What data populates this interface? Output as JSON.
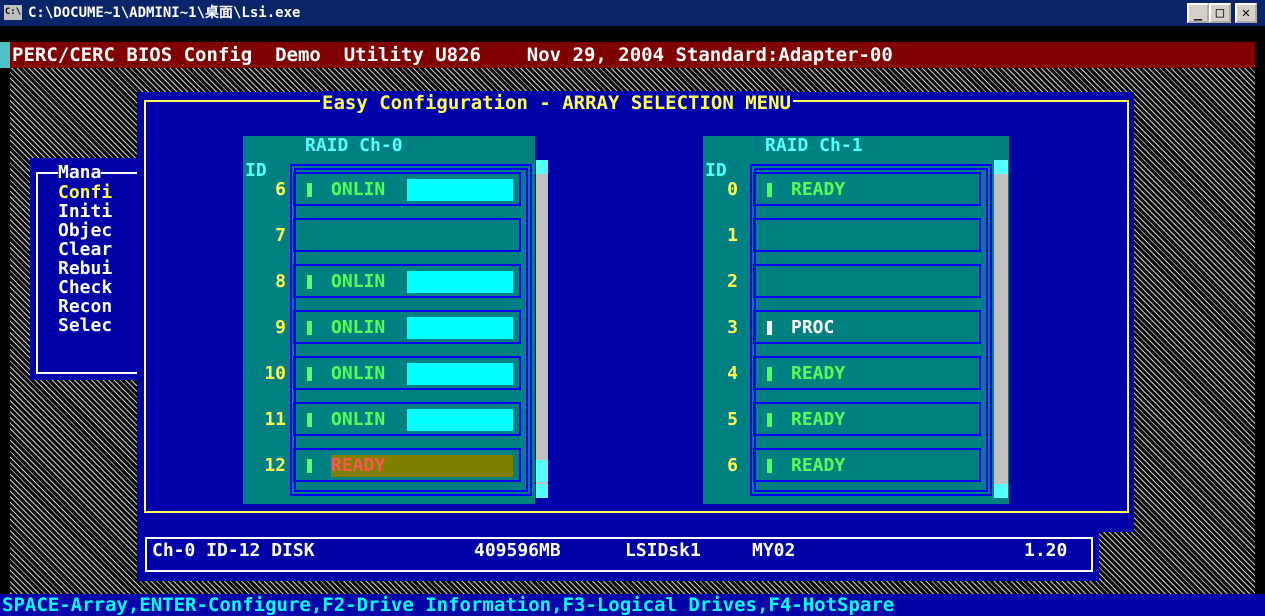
{
  "window": {
    "title": "C:\\DOCUME~1\\ADMINI~1\\桌面\\Lsi.exe",
    "icon": "console-icon",
    "buttons": {
      "minimize": "_",
      "maximize": "□",
      "close": "✕"
    }
  },
  "header": "PERC/CERC BIOS Config  Demo  Utility U826    Nov 29, 2004 Standard:Adapter-00",
  "dialog": {
    "title": "Easy Configuration - ARRAY SELECTION MENU"
  },
  "management_menu": {
    "title": "Mana",
    "items": [
      "Confi",
      "Initi",
      "Objec",
      "Clear",
      "Rebui",
      "Check",
      "Recon",
      "Selec"
    ],
    "selected_index": 0
  },
  "channels": [
    {
      "title": "RAID Ch-0",
      "id_label": "ID",
      "disks": [
        {
          "id": "6",
          "status": "ONLIN",
          "state": "online"
        },
        {
          "id": "7",
          "status": "",
          "state": "empty"
        },
        {
          "id": "8",
          "status": "ONLIN",
          "state": "online"
        },
        {
          "id": "9",
          "status": "ONLIN",
          "state": "online"
        },
        {
          "id": "10",
          "status": "ONLIN",
          "state": "online"
        },
        {
          "id": "11",
          "status": "ONLIN",
          "state": "online"
        },
        {
          "id": "12",
          "status": "READY",
          "state": "selected"
        }
      ]
    },
    {
      "title": "RAID Ch-1",
      "id_label": "ID",
      "disks": [
        {
          "id": "0",
          "status": "READY",
          "state": "ready"
        },
        {
          "id": "1",
          "status": "",
          "state": "empty"
        },
        {
          "id": "2",
          "status": "",
          "state": "empty"
        },
        {
          "id": "3",
          "status": "PROC",
          "state": "proc"
        },
        {
          "id": "4",
          "status": "READY",
          "state": "ready"
        },
        {
          "id": "5",
          "status": "READY",
          "state": "ready"
        },
        {
          "id": "6",
          "status": "READY",
          "state": "ready"
        }
      ]
    }
  ],
  "info": {
    "location": "Ch-0 ID-12 DISK",
    "size": "409596MB",
    "vendor": "LSIDsk1",
    "model": "MY02",
    "revision": "1.20"
  },
  "footer": "SPACE-Array,ENTER-Configure,F2-Drive Information,F3-Logical Drives,F4-HotSpare",
  "colors": {
    "online_text": "#55ff55",
    "ready_text": "#55ff55",
    "proc_text": "#ffffff",
    "online_bar": "#00ffff",
    "selected_bg": "#808000",
    "selected_text": "#ff5555"
  }
}
